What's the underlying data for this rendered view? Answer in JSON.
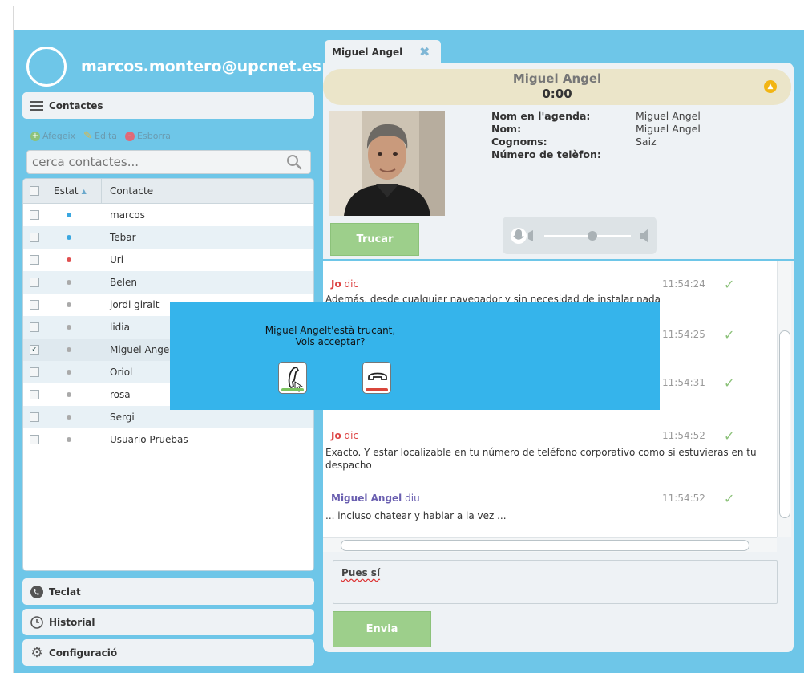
{
  "user": {
    "email": "marcos.montero@upcnet.es"
  },
  "contacts_panel": {
    "title": "Contactes",
    "actions": {
      "add": "Afegeix",
      "edit": "Edita",
      "delete": "Esborra"
    },
    "search_placeholder": "cerca contactes...",
    "columns": {
      "state": "Estat",
      "contact": "Contacte"
    },
    "rows": [
      {
        "name": "marcos",
        "status": "online",
        "status_color": "#3aa7e0",
        "checked": false
      },
      {
        "name": "Tebar",
        "status": "online",
        "status_color": "#3aa7e0",
        "checked": false
      },
      {
        "name": "Uri",
        "status": "busy",
        "status_color": "#e05050",
        "checked": false
      },
      {
        "name": "Belen",
        "status": "offline",
        "status_color": "#aaaaaa",
        "checked": false
      },
      {
        "name": "jordi giralt",
        "status": "offline",
        "status_color": "#aaaaaa",
        "checked": false
      },
      {
        "name": "lidia",
        "status": "offline",
        "status_color": "#aaaaaa",
        "checked": false
      },
      {
        "name": "Miguel Angel",
        "status": "offline",
        "status_color": "#aaaaaa",
        "checked": true
      },
      {
        "name": "Oriol",
        "status": "offline",
        "status_color": "#aaaaaa",
        "checked": false
      },
      {
        "name": "rosa",
        "status": "offline",
        "status_color": "#aaaaaa",
        "checked": false
      },
      {
        "name": "Sergi",
        "status": "offline",
        "status_color": "#aaaaaa",
        "checked": false
      },
      {
        "name": "Usuario Pruebas",
        "status": "offline",
        "status_color": "#aaaaaa",
        "checked": false
      }
    ]
  },
  "bottom_nav": {
    "keypad": "Teclat",
    "history": "Historial",
    "settings": "Configuració"
  },
  "conversation": {
    "tab_label": "Miguel Angel",
    "call_name": "Miguel Angel",
    "call_time": "0:00",
    "info": {
      "agenda_label": "Nom en l'agenda:",
      "agenda_value": "Miguel Angel",
      "name_label": "Nom:",
      "name_value": "Miguel Angel",
      "surname_label": "Cognoms:",
      "surname_value": "Saiz",
      "phone_label": "Número de telèfon:",
      "phone_value": ""
    },
    "call_button": "Trucar",
    "messages": [
      {
        "who": "Jo",
        "verb": "dic",
        "time": "11:54:24",
        "text": "Además, desde cualquier navegador y sin necesidad de instalar nada"
      },
      {
        "who": "",
        "verb": "",
        "time": "11:54:25",
        "text": ""
      },
      {
        "who": "",
        "verb": "",
        "time": "11:54:31",
        "text": ""
      },
      {
        "who": "Jo",
        "verb": "dic",
        "time": "11:54:52",
        "text": "Exacto. Y estar localizable en tu número de teléfono corporativo como si estuvieras en tu despacho"
      },
      {
        "who": "Miguel Angel",
        "verb": "diu",
        "time": "11:54:52",
        "text": "... incluso chatear y hablar a la vez ..."
      }
    ],
    "compose_text": "Pues sí",
    "send_button": "Envia"
  },
  "dialog": {
    "line1": "Miguel Angelt'està trucant,",
    "line2": "Vols acceptar?",
    "accept_color": "#7cc45e",
    "reject_color": "#d9463b"
  },
  "colors": {
    "app_bg": "#6ec6e8",
    "panel": "#eef2f5",
    "accent_green": "#9dcf8b",
    "dialog_bg": "#35b4eb"
  }
}
